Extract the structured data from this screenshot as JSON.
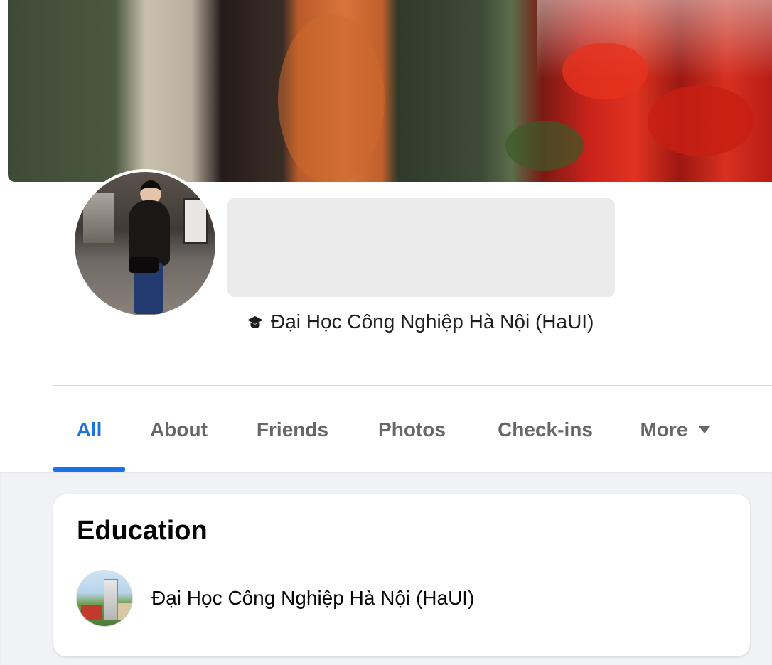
{
  "profile": {
    "school": "Đại Học Công Nghiệp Hà Nội (HaUI)"
  },
  "tabs": [
    {
      "label": "All",
      "active": true
    },
    {
      "label": "About",
      "active": false
    },
    {
      "label": "Friends",
      "active": false
    },
    {
      "label": "Photos",
      "active": false
    },
    {
      "label": "Check-ins",
      "active": false
    },
    {
      "label": "More",
      "active": false
    }
  ],
  "education": {
    "title": "Education",
    "items": [
      {
        "name": "Đại Học Công Nghiệp Hà Nội (HaUI)"
      }
    ]
  },
  "colors": {
    "accent": "#1b74e4",
    "tab_inactive": "#65676b",
    "background": "#f0f2f5"
  }
}
